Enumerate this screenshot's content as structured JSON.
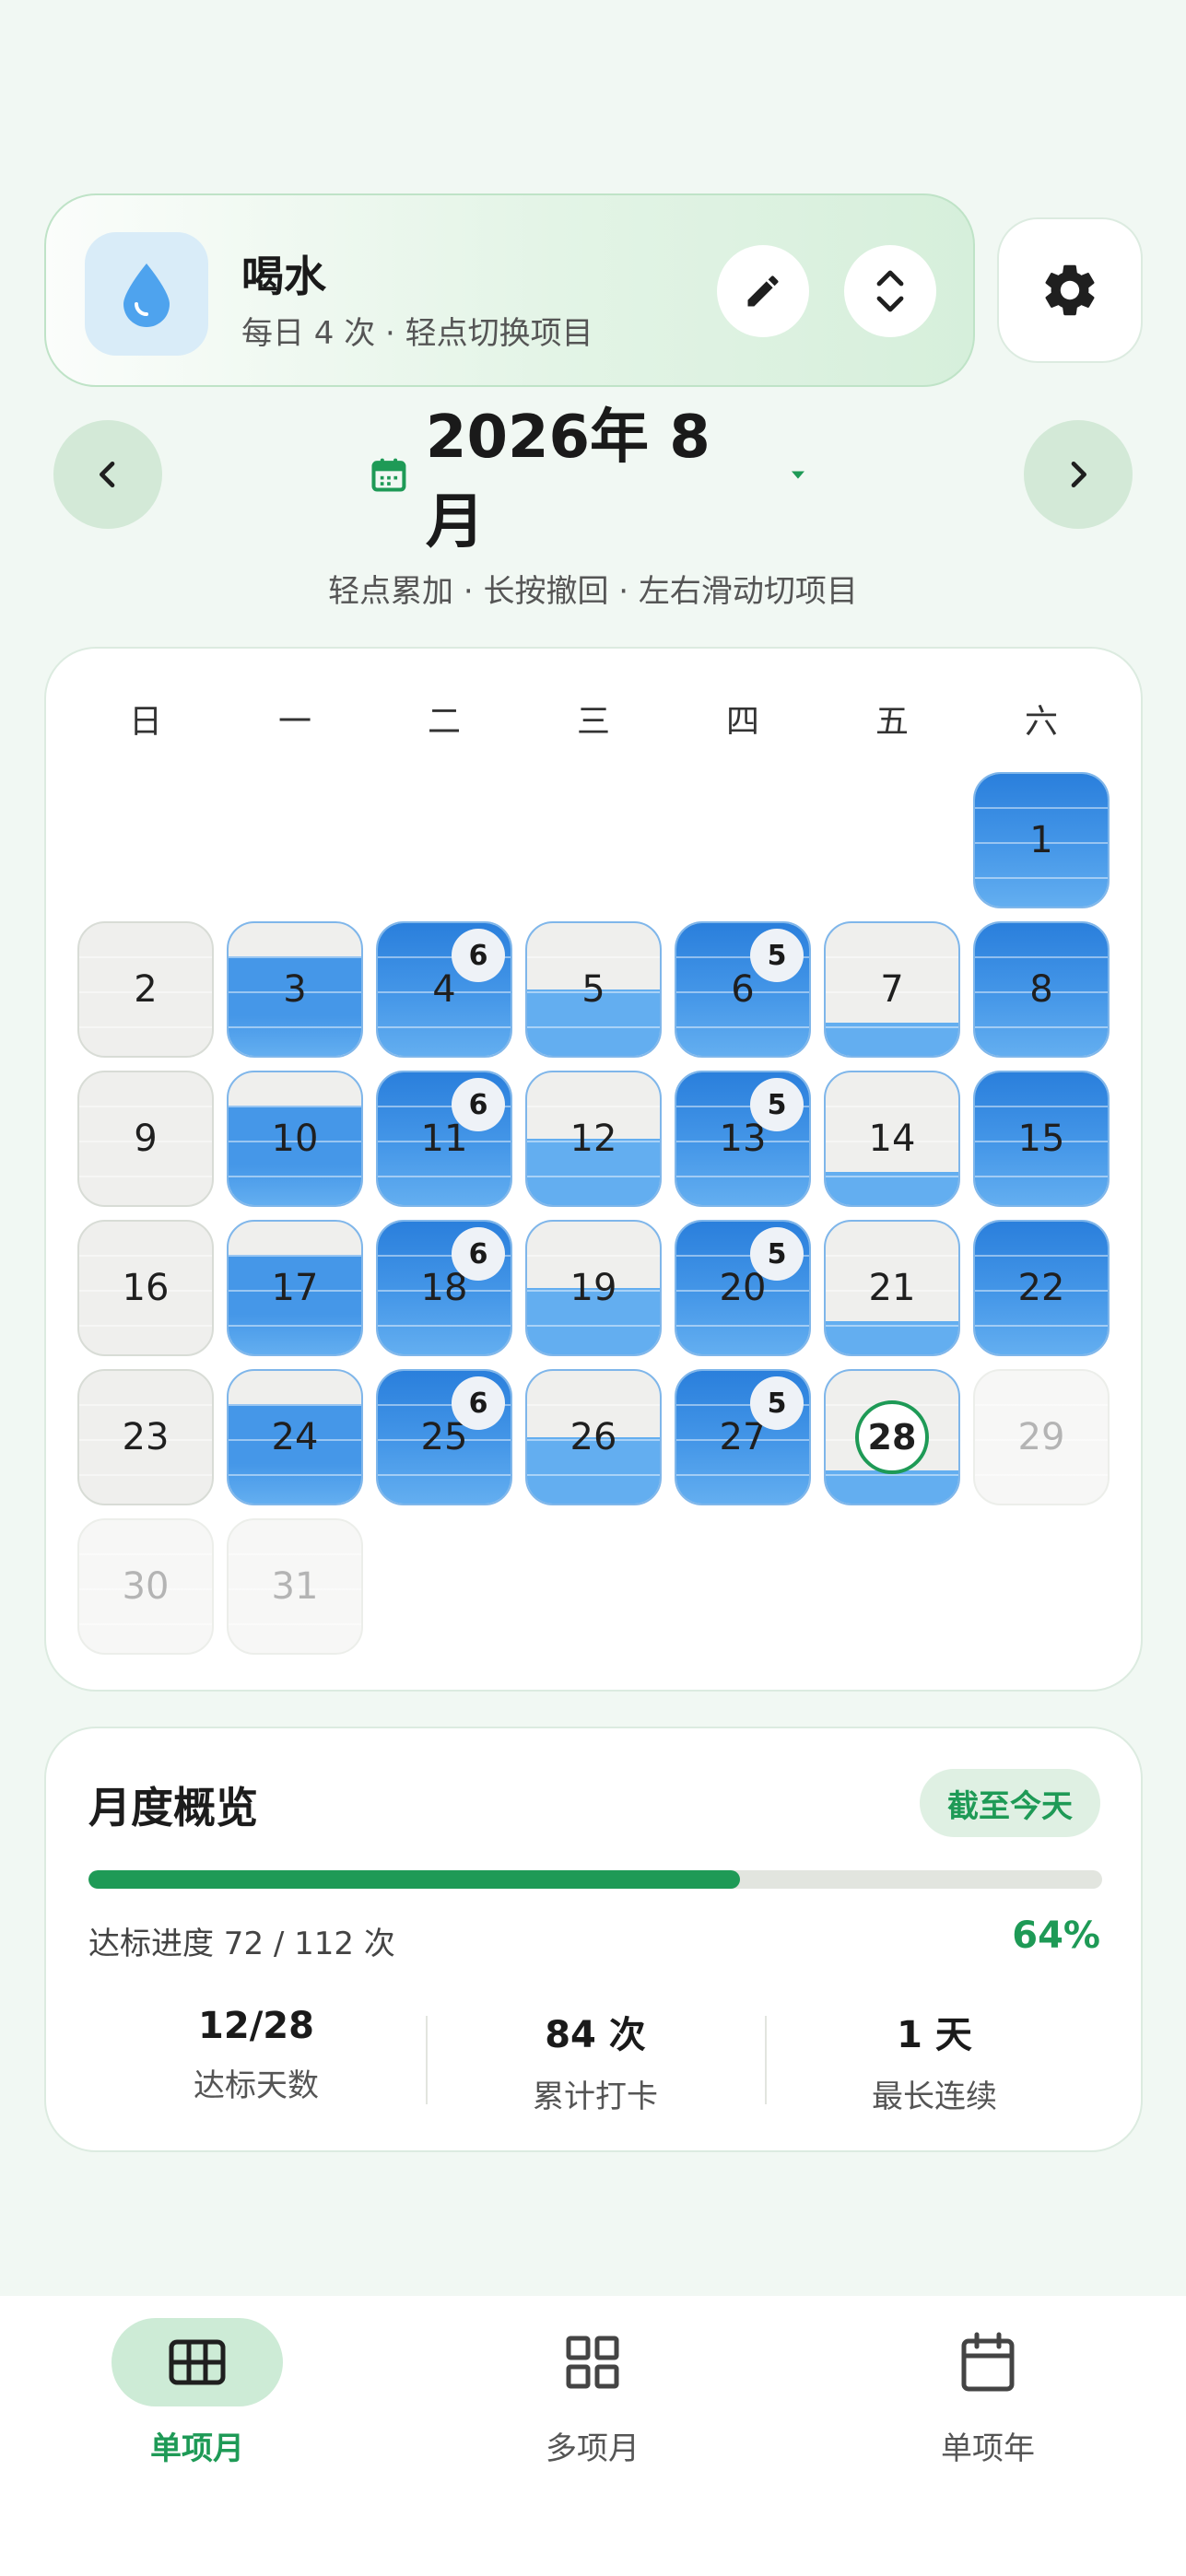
{
  "item": {
    "name": "喝水",
    "subtitle": "每日 4 次 · 轻点切换项目"
  },
  "month": {
    "label": "2026年 8月",
    "hint": "轻点累加 · 长按撤回 · 左右滑动切项目"
  },
  "weekdays": [
    "日",
    "一",
    "二",
    "三",
    "四",
    "五",
    "六"
  ],
  "calendar": {
    "first_weekday": 6,
    "days_in_month": 31,
    "today": 28,
    "daily_target": 4,
    "days": [
      {
        "day": 1,
        "count": 4
      },
      {
        "day": 2,
        "count": 0
      },
      {
        "day": 3,
        "count": 3
      },
      {
        "day": 4,
        "count": 6
      },
      {
        "day": 5,
        "count": 2
      },
      {
        "day": 6,
        "count": 5
      },
      {
        "day": 7,
        "count": 1
      },
      {
        "day": 8,
        "count": 4
      },
      {
        "day": 9,
        "count": 0
      },
      {
        "day": 10,
        "count": 3
      },
      {
        "day": 11,
        "count": 6
      },
      {
        "day": 12,
        "count": 2
      },
      {
        "day": 13,
        "count": 5
      },
      {
        "day": 14,
        "count": 1
      },
      {
        "day": 15,
        "count": 4
      },
      {
        "day": 16,
        "count": 0
      },
      {
        "day": 17,
        "count": 3
      },
      {
        "day": 18,
        "count": 6
      },
      {
        "day": 19,
        "count": 2
      },
      {
        "day": 20,
        "count": 5
      },
      {
        "day": 21,
        "count": 1
      },
      {
        "day": 22,
        "count": 4
      },
      {
        "day": 23,
        "count": 0
      },
      {
        "day": 24,
        "count": 3
      },
      {
        "day": 25,
        "count": 6
      },
      {
        "day": 26,
        "count": 2
      },
      {
        "day": 27,
        "count": 5
      },
      {
        "day": 28,
        "count": 1
      },
      {
        "day": 29,
        "count": null
      },
      {
        "day": 30,
        "count": null
      },
      {
        "day": 31,
        "count": null
      }
    ]
  },
  "overview": {
    "title": "月度概览",
    "pill": "截至今天",
    "progress_value": 72,
    "progress_total": 112,
    "progress_text": "达标进度 72 / 112 次",
    "percent": "64%",
    "stats": [
      {
        "value": "12/28",
        "label": "达标天数"
      },
      {
        "value": "84 次",
        "label": "累计打卡"
      },
      {
        "value": "1 天",
        "label": "最长连续"
      }
    ]
  },
  "tabs": [
    {
      "label": "单项月",
      "icon": "grid-table-icon",
      "active": true
    },
    {
      "label": "多项月",
      "icon": "four-squares-icon",
      "active": false
    },
    {
      "label": "单项年",
      "icon": "calendar-icon",
      "active": false
    }
  ],
  "colors": {
    "accent": "#1e9a56",
    "water_light": "#63aef0",
    "water_mid": "#4597e8",
    "water_dark": "#2a7fdc"
  }
}
